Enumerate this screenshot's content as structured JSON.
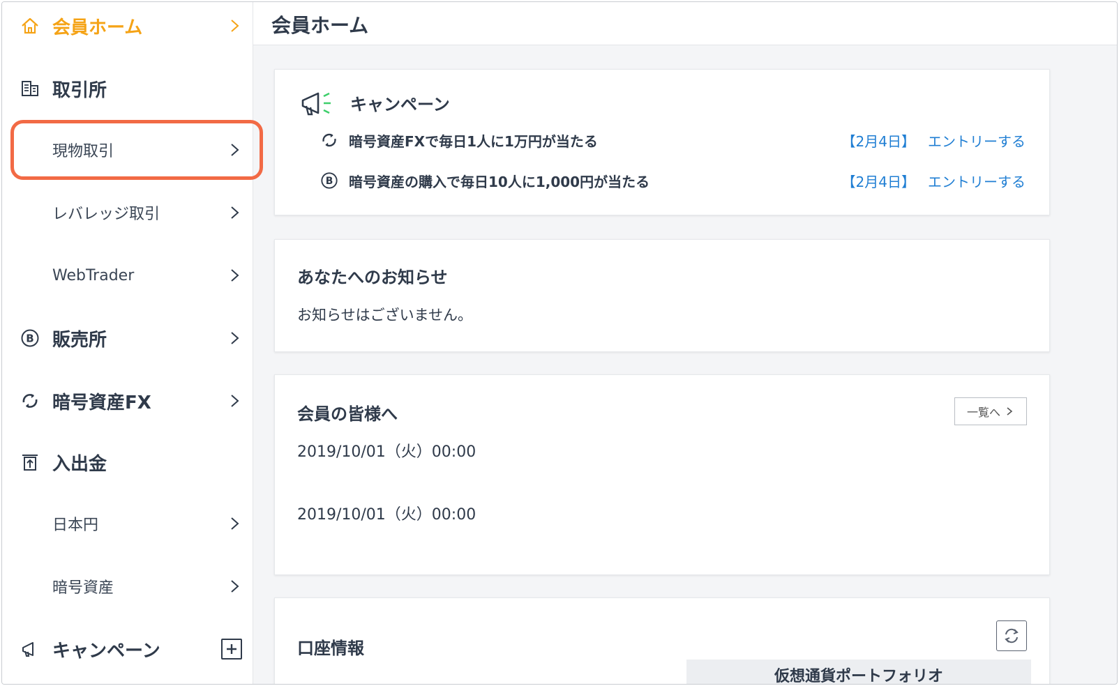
{
  "sidebar": {
    "items": [
      {
        "label": "会員ホーム",
        "icon": "home-icon",
        "active": true
      },
      {
        "label": "取引所",
        "icon": "exchange-building-icon"
      },
      {
        "label": "現物取引",
        "sub": true,
        "highlighted": true
      },
      {
        "label": "レバレッジ取引",
        "sub": true
      },
      {
        "label": "WebTrader",
        "sub": true
      },
      {
        "label": "販売所",
        "icon": "bitcoin-icon"
      },
      {
        "label": "暗号資産FX",
        "icon": "fx-cycle-icon"
      },
      {
        "label": "入出金",
        "icon": "deposit-withdraw-icon"
      },
      {
        "label": "日本円",
        "sub": true
      },
      {
        "label": "暗号資産",
        "sub": true
      },
      {
        "label": "キャンペーン",
        "icon": "megaphone-icon"
      }
    ]
  },
  "header": {
    "title": "会員ホーム"
  },
  "campaign": {
    "title": "キャンペーン",
    "rows": [
      {
        "icon": "fx-cycle-icon",
        "text": "暗号資産FXで毎日1人に1万円が当たる",
        "date": "【2月4日】",
        "link": "エントリーする"
      },
      {
        "icon": "bitcoin-icon",
        "text": "暗号資産の購入で毎日10人に1,000円が当たる",
        "date": "【2月4日】",
        "link": "エントリーする"
      }
    ]
  },
  "notices": {
    "title": "あなたへのお知らせ",
    "empty_text": "お知らせはございません。"
  },
  "members": {
    "title": "会員の皆様へ",
    "list_button": "一覧へ",
    "entries": [
      "2019/10/01（火）00:00",
      "2019/10/01（火）00:00"
    ]
  },
  "account": {
    "title": "口座情報",
    "portfolio_tab": "仮想通貨ポートフォリオ"
  },
  "colors": {
    "accent": "#f5a316",
    "link": "#1f7ed3",
    "highlight": "#f26a45"
  }
}
